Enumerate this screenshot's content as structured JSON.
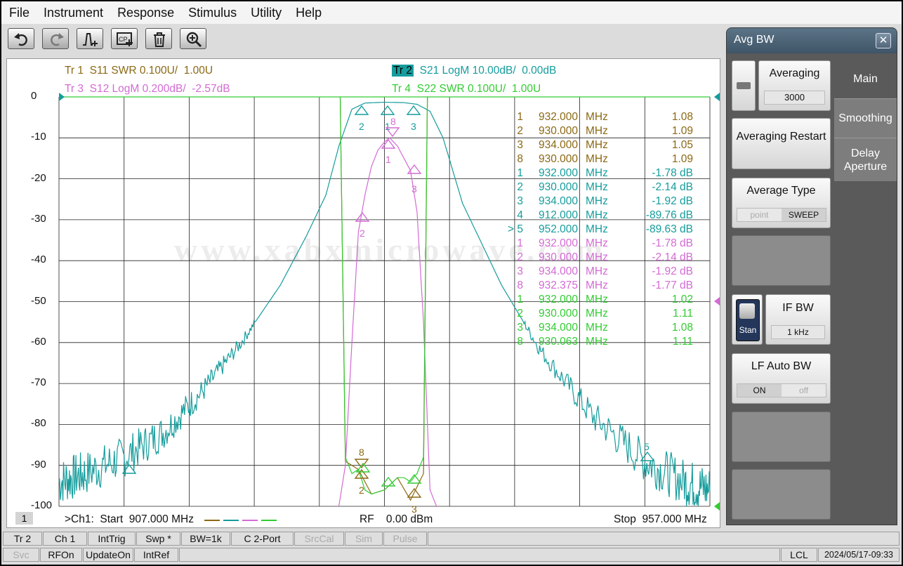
{
  "menu": [
    "File",
    "Instrument",
    "Response",
    "Stimulus",
    "Utility",
    "Help"
  ],
  "toolbar": {
    "icons": [
      "undo-icon",
      "redo-icon",
      "add-marker-icon",
      "save-screen-icon",
      "delete-icon",
      "zoom-icon"
    ]
  },
  "traces": [
    {
      "id": "Tr 1",
      "label": "S11 SWR 0.100U/  1.00U",
      "color": "#8b6914"
    },
    {
      "id": "Tr 2",
      "label": "S21 LogM 10.00dB/  0.00dB",
      "color": "#169c9c",
      "active": true
    },
    {
      "id": "Tr 3",
      "label": "S12 LogM 0.200dB/  -2.57dB",
      "color": "#d36bd3"
    },
    {
      "id": "Tr 4",
      "label": "S22 SWR 0.100U/  1.00U",
      "color": "#33cc33"
    }
  ],
  "markers": [
    {
      "idx": "1",
      "freq": "932.000",
      "unit": "MHz",
      "val": "1.08",
      "color": "#8b6914"
    },
    {
      "idx": "2",
      "freq": "930.000",
      "unit": "MHz",
      "val": "1.09",
      "color": "#8b6914"
    },
    {
      "idx": "3",
      "freq": "934.000",
      "unit": "MHz",
      "val": "1.05",
      "color": "#8b6914"
    },
    {
      "idx": "8",
      "freq": "930.000",
      "unit": "MHz",
      "val": "1.09",
      "color": "#8b6914"
    },
    {
      "idx": "1",
      "freq": "932.000",
      "unit": "MHz",
      "val": "-1.78 dB",
      "color": "#169c9c"
    },
    {
      "idx": "2",
      "freq": "930.000",
      "unit": "MHz",
      "val": "-2.14 dB",
      "color": "#169c9c"
    },
    {
      "idx": "3",
      "freq": "934.000",
      "unit": "MHz",
      "val": "-1.92 dB",
      "color": "#169c9c"
    },
    {
      "idx": "4",
      "freq": "912.000",
      "unit": "MHz",
      "val": "-89.76 dB",
      "color": "#169c9c"
    },
    {
      "idx": "> 5",
      "freq": "952.000",
      "unit": "MHz",
      "val": "-89.63 dB",
      "color": "#169c9c"
    },
    {
      "idx": "1",
      "freq": "932.000",
      "unit": "MHz",
      "val": "-1.78 dB",
      "color": "#d36bd3"
    },
    {
      "idx": "2",
      "freq": "930.000",
      "unit": "MHz",
      "val": "-2.14 dB",
      "color": "#d36bd3"
    },
    {
      "idx": "3",
      "freq": "934.000",
      "unit": "MHz",
      "val": "-1.92 dB",
      "color": "#d36bd3"
    },
    {
      "idx": "8",
      "freq": "932.375",
      "unit": "MHz",
      "val": "-1.77 dB",
      "color": "#d36bd3"
    },
    {
      "idx": "1",
      "freq": "932.000",
      "unit": "MHz",
      "val": "1.02",
      "color": "#33cc33"
    },
    {
      "idx": "2",
      "freq": "930.000",
      "unit": "MHz",
      "val": "1.11",
      "color": "#33cc33"
    },
    {
      "idx": "3",
      "freq": "934.000",
      "unit": "MHz",
      "val": "1.08",
      "color": "#33cc33"
    },
    {
      "idx": "8",
      "freq": "930.063",
      "unit": "MHz",
      "val": "1.11",
      "color": "#33cc33"
    }
  ],
  "yticks": [
    "0",
    "-10",
    "-20",
    "-30",
    "-40",
    "-50",
    "-60",
    "-70",
    "-80",
    "-90",
    "-100"
  ],
  "watermark": "www.xabxmicrowave.com",
  "footer": {
    "channel_box": "1",
    "start": ">Ch1:  Start  907.000 MHz",
    "rf": "RF    0.00 dBm",
    "stop": "Stop  957.000 MHz"
  },
  "softkeys": {
    "title": "Avg BW",
    "close": "✕",
    "tabs": [
      "Main",
      "Smoothing",
      "Delay Aperture"
    ],
    "averaging": {
      "label": "Averaging",
      "value": "3000"
    },
    "restart": "Averaging Restart",
    "avg_type": {
      "label": "Average Type",
      "opt1": "point",
      "opt2": "SWEEP"
    },
    "stan": "Stan",
    "ifbw": {
      "label": "IF BW",
      "value": "1 kHz"
    },
    "lfauto": {
      "label": "LF Auto BW",
      "on": "ON",
      "off": "off"
    }
  },
  "status1": [
    "Tr 2",
    "Ch 1",
    "IntTrig",
    "Swp *",
    "BW=1k",
    "C  2-Port",
    "SrcCal",
    "Sim",
    "Pulse"
  ],
  "status2": [
    "Svc",
    "RFOn",
    "UpdateOn",
    "IntRef",
    "LCL",
    "2024/05/17-09:33"
  ],
  "chart_data": {
    "type": "line",
    "x_range_mhz": [
      907,
      957
    ],
    "y_range": [
      -100,
      0
    ],
    "grid": true,
    "series": [
      {
        "name": "Tr 1",
        "color": "#8b6914",
        "x": [
          928.6,
          929.0,
          930.0,
          931.0,
          932.0,
          933.0,
          934.0,
          935.0,
          935.3
        ],
        "y": [
          0,
          -89,
          -91,
          -97,
          -96,
          -93,
          -98.5,
          -92,
          0
        ]
      },
      {
        "name": "Tr 2",
        "color": "#169c9c",
        "x": [
          907,
          909,
          912,
          915,
          918,
          921,
          924,
          926,
          927.5,
          928.5,
          929.5,
          930.5,
          932,
          933.5,
          934.5,
          935.5,
          936.5,
          938,
          941,
          944,
          948,
          952,
          955,
          957
        ],
        "y": [
          -94,
          -92,
          -88,
          -82,
          -72,
          -60,
          -46,
          -34,
          -24,
          -12,
          -3,
          -1.5,
          -1.3,
          -1.4,
          -1.8,
          -3.5,
          -10,
          -26,
          -46,
          -62,
          -78,
          -89,
          -94,
          -96
        ]
      },
      {
        "name": "Tr 3",
        "color": "#d36bd3",
        "x": [
          928.5,
          929.0,
          929.5,
          930.0,
          930.5,
          931.0,
          931.5,
          932.0,
          932.4,
          933.0,
          933.5,
          934.0,
          934.5,
          935.0,
          935.5,
          936.0
        ],
        "y": [
          -100,
          -90,
          -60,
          -33,
          -24,
          -17,
          -13,
          -11,
          -10,
          -12,
          -15,
          -18,
          -28,
          -55,
          -96,
          -100
        ]
      },
      {
        "name": "Tr 4",
        "color": "#33cc33",
        "x": [
          928.6,
          929.0,
          929.5,
          930.0,
          930.5,
          931.0,
          932.0,
          933.0,
          933.5,
          934.0,
          934.5,
          935.0,
          935.3
        ],
        "y": [
          0,
          -88,
          -92,
          -91,
          -96,
          -97,
          -96,
          -93,
          -93,
          -94,
          -92,
          -88,
          0
        ]
      }
    ]
  }
}
